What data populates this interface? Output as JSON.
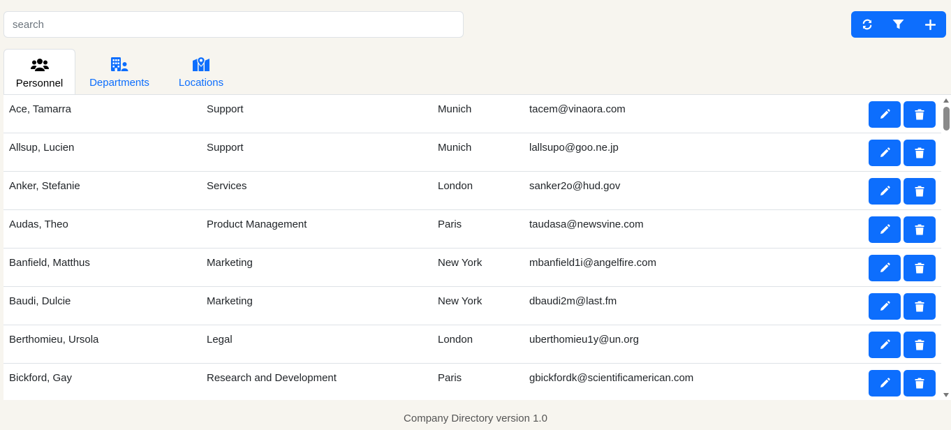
{
  "search": {
    "placeholder": "search",
    "value": ""
  },
  "toolbar": {
    "icons": [
      "refresh-icon",
      "filter-icon",
      "plus-icon"
    ]
  },
  "tabs": [
    {
      "label": "Personnel",
      "icon": "users-icon",
      "active": true
    },
    {
      "label": "Departments",
      "icon": "building-user-icon",
      "active": false
    },
    {
      "label": "Locations",
      "icon": "map-location-icon",
      "active": false
    }
  ],
  "personnel": [
    {
      "name": "Ace, Tamarra",
      "department": "Support",
      "location": "Munich",
      "email": "tacem@vinaora.com"
    },
    {
      "name": "Allsup, Lucien",
      "department": "Support",
      "location": "Munich",
      "email": "lallsupo@goo.ne.jp"
    },
    {
      "name": "Anker, Stefanie",
      "department": "Services",
      "location": "London",
      "email": "sanker2o@hud.gov"
    },
    {
      "name": "Audas, Theo",
      "department": "Product Management",
      "location": "Paris",
      "email": "taudasa@newsvine.com"
    },
    {
      "name": "Banfield, Matthus",
      "department": "Marketing",
      "location": "New York",
      "email": "mbanfield1i@angelfire.com"
    },
    {
      "name": "Baudi, Dulcie",
      "department": "Marketing",
      "location": "New York",
      "email": "dbaudi2m@last.fm"
    },
    {
      "name": "Berthomieu, Ursola",
      "department": "Legal",
      "location": "London",
      "email": "uberthomieu1y@un.org"
    },
    {
      "name": "Bickford, Gay",
      "department": "Research and Development",
      "location": "Paris",
      "email": "gbickfordk@scientificamerican.com"
    }
  ],
  "colors": {
    "accent": "#0d6efd",
    "background": "#f7f5ef"
  },
  "footer": {
    "text": "Company Directory version 1.0"
  }
}
